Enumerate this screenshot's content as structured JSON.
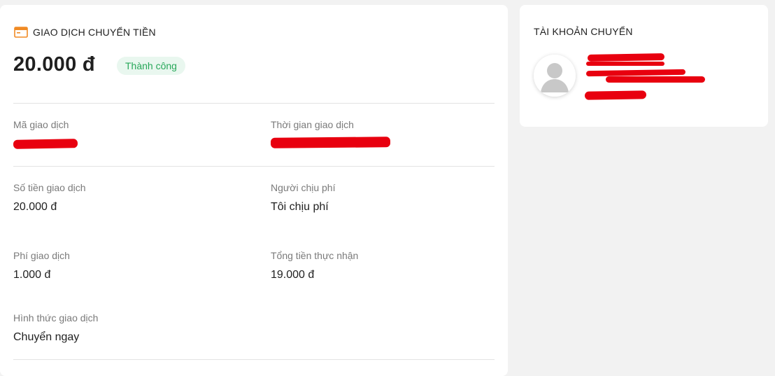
{
  "transfer": {
    "section_title": "GIAO DỊCH CHUYỂN TIỀN",
    "amount": "20.000 đ",
    "status": "Thành công",
    "fields": {
      "ma_giao_dich": {
        "label": "Mã giao dịch",
        "value": ""
      },
      "thoi_gian": {
        "label": "Thời gian giao dịch",
        "value": ""
      },
      "so_tien": {
        "label": "Số tiền giao dịch",
        "value": "20.000 đ"
      },
      "nguoi_chiu_phi": {
        "label": "Người chịu phí",
        "value": "Tôi chịu phí"
      },
      "phi": {
        "label": "Phí giao dịch",
        "value": "1.000 đ"
      },
      "tong_tien": {
        "label": "Tổng tiền thực nhận",
        "value": "19.000 đ"
      },
      "hinh_thuc": {
        "label": "Hình thức giao dịch",
        "value": "Chuyển ngay"
      }
    }
  },
  "account": {
    "title": "TÀI KHOẢN CHUYỂN"
  },
  "colors": {
    "status_text": "#28a85a",
    "status_bg": "#e9f7ef",
    "accent_icon": "#f08a24",
    "redaction": "#e8000f"
  },
  "icons": {
    "header": "browser-window-icon",
    "avatar": "user-silhouette-icon"
  }
}
